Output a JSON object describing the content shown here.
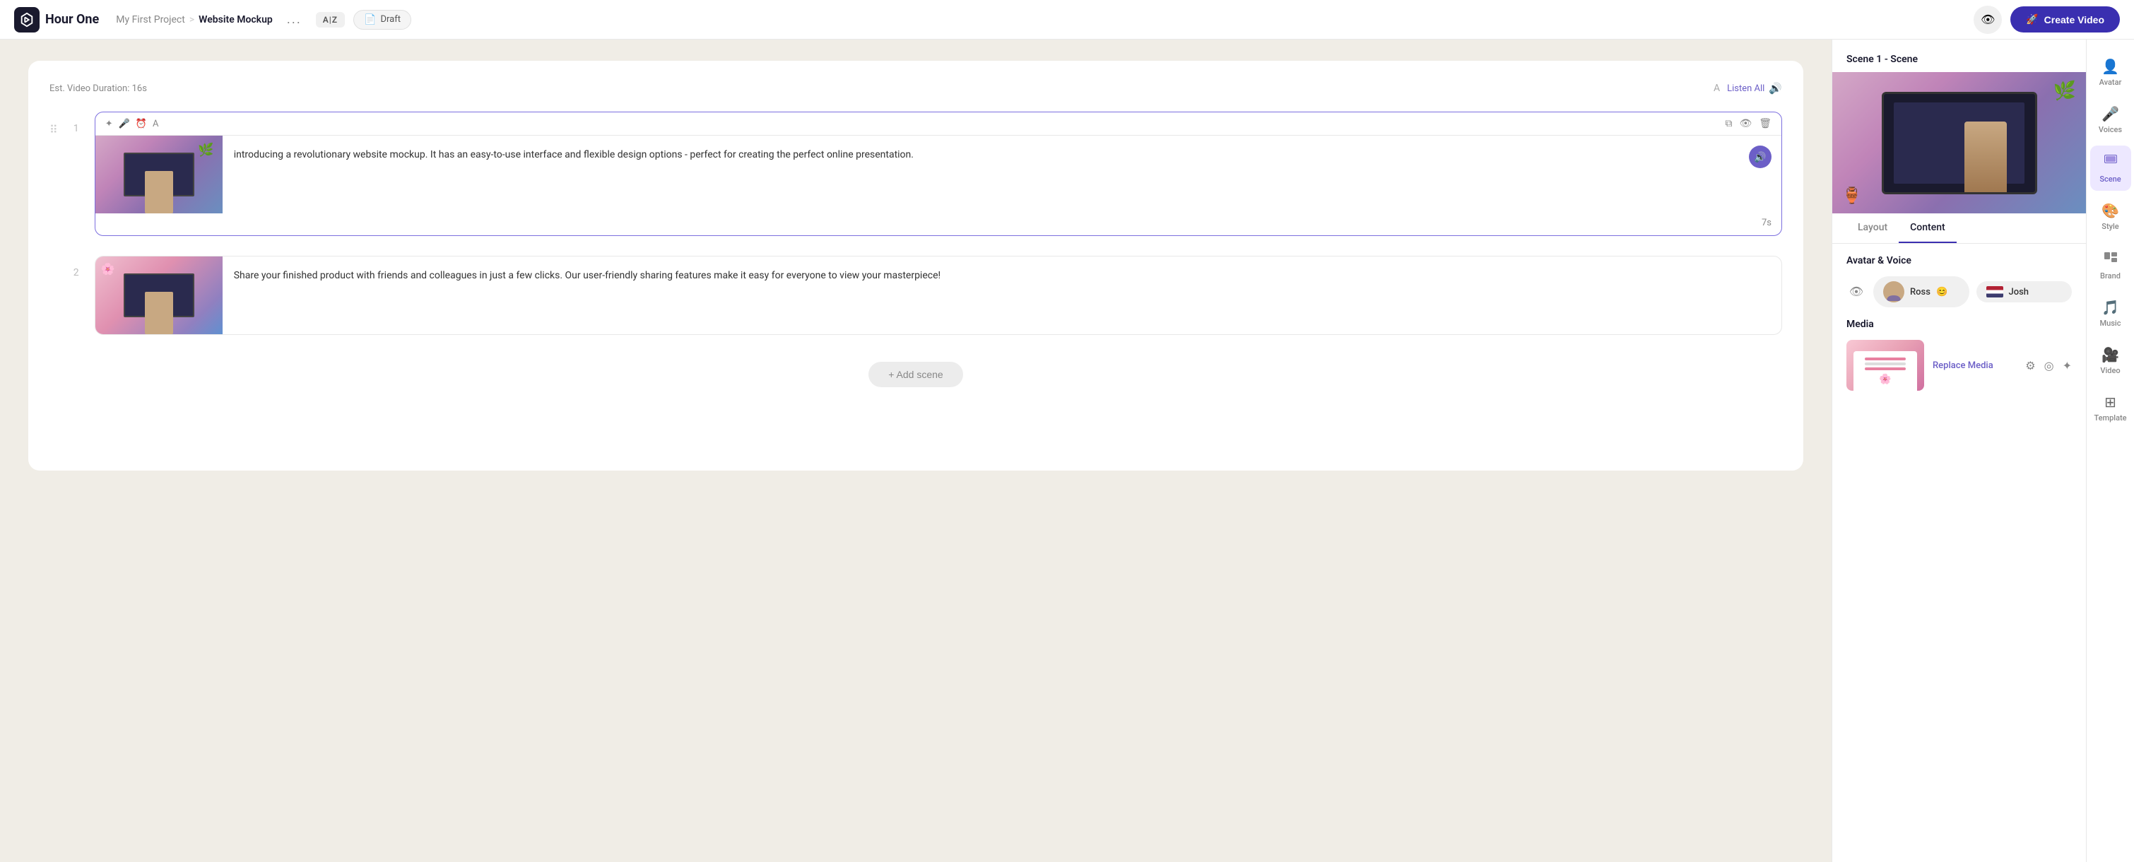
{
  "app": {
    "logo_text": "Hour One",
    "logo_icon": "⬡"
  },
  "breadcrumb": {
    "project": "My First Project",
    "separator": ">",
    "current": "Website Mockup"
  },
  "header": {
    "more_label": "...",
    "az_badge": "A|Z",
    "draft_label": "Draft",
    "eye_icon": "👁",
    "create_button": "Create Video"
  },
  "editor": {
    "duration_label": "Est. Video Duration: 16s",
    "listen_all": "Listen All",
    "add_scene_label": "+ Add scene"
  },
  "scenes": [
    {
      "number": "1",
      "text": "introducing a revolutionary website mockup. It has an easy-to-use interface and flexible design options - perfect for creating the perfect online presentation.",
      "duration": "7s",
      "active": true
    },
    {
      "number": "2",
      "text": "Share your finished product with friends and colleagues in just a few clicks. Our user-friendly sharing features make it easy for everyone to view your masterpiece!",
      "duration": "",
      "active": false
    }
  ],
  "right_panel": {
    "scene_label": "Scene 1 - Scene",
    "tabs": [
      "Layout",
      "Content"
    ],
    "active_tab": "Content",
    "avatar_voice_section": "Avatar & Voice",
    "avatar_name": "Ross",
    "avatar_emoji": "😊",
    "voice_name": "Josh",
    "media_section": "Media",
    "replace_media": "Replace Media"
  },
  "sidebar": {
    "items": [
      {
        "id": "avatar",
        "icon": "👤",
        "label": "Avatar"
      },
      {
        "id": "voices",
        "icon": "🎤",
        "label": "Voices"
      },
      {
        "id": "scene",
        "icon": "🎬",
        "label": "Scene",
        "active": true
      },
      {
        "id": "style",
        "icon": "🎨",
        "label": "Style"
      },
      {
        "id": "brand",
        "icon": "📊",
        "label": "Brand"
      },
      {
        "id": "music",
        "icon": "🎵",
        "label": "Music"
      },
      {
        "id": "video",
        "icon": "🎥",
        "label": "Video"
      },
      {
        "id": "template",
        "icon": "⊞",
        "label": "Template"
      }
    ]
  }
}
